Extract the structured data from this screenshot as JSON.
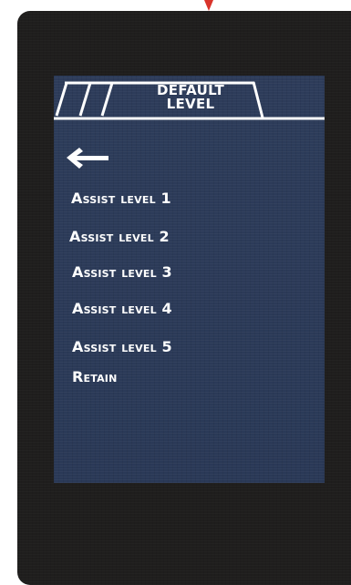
{
  "header": {
    "title_line1": "DEFAULT",
    "title_line2": "LEVEL"
  },
  "back_icon": "left-arrow-icon",
  "menu": {
    "items": [
      {
        "label": "Assist level 1"
      },
      {
        "label": "Assist level 2"
      },
      {
        "label": "Assist level 3"
      },
      {
        "label": "Assist level 4"
      },
      {
        "label": "Assist level 5"
      },
      {
        "label": "Retain"
      }
    ]
  },
  "colors": {
    "device_body": "#1f1e1d",
    "screen_background": "#2b3a58",
    "text": "#ffffff",
    "top_marker": "#d9342b"
  }
}
